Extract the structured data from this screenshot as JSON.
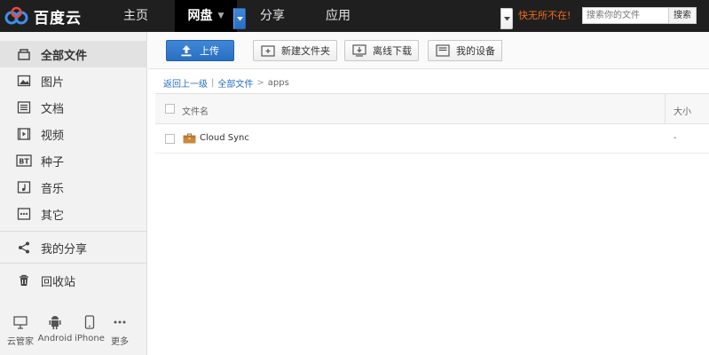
{
  "brand": {
    "name": "百度云"
  },
  "nav": {
    "items": [
      {
        "label": "主页"
      },
      {
        "label": "网盘"
      },
      {
        "label": "分享"
      },
      {
        "label": "应用"
      }
    ]
  },
  "promo": {
    "text": "快无所不在!"
  },
  "search": {
    "placeholder": "搜索你的文件",
    "button_label": "搜索"
  },
  "sidebar": {
    "items": [
      {
        "label": "全部文件",
        "icon": "all-files-icon"
      },
      {
        "label": "图片",
        "icon": "image-icon"
      },
      {
        "label": "文档",
        "icon": "document-icon"
      },
      {
        "label": "视频",
        "icon": "video-icon"
      },
      {
        "label": "种子",
        "icon": "bt-icon"
      },
      {
        "label": "音乐",
        "icon": "music-icon"
      },
      {
        "label": "其它",
        "icon": "other-icon"
      },
      {
        "label": "我的分享",
        "icon": "share-icon"
      },
      {
        "label": "回收站",
        "icon": "trash-icon"
      }
    ],
    "devices": [
      {
        "label": "云管家",
        "icon": "desktop-icon"
      },
      {
        "label": "Android",
        "icon": "android-icon"
      },
      {
        "label": "iPhone",
        "icon": "iphone-icon"
      },
      {
        "label": "更多",
        "icon": "more-icon"
      }
    ]
  },
  "toolbar": {
    "upload_label": "上传",
    "new_folder_label": "新建文件夹",
    "offline_download_label": "离线下载",
    "my_devices_label": "我的设备"
  },
  "breadcrumb": {
    "back_label": "返回上一级",
    "divider": "|",
    "root_label": "全部文件",
    "arrow": ">",
    "current": "apps"
  },
  "file_list": {
    "columns": {
      "name": "文件名",
      "size": "大小"
    },
    "rows": [
      {
        "name": "Cloud Sync",
        "size": "-",
        "icon": "folder-icon"
      }
    ]
  },
  "colors": {
    "topbar_bg": "#1f1f1f",
    "accent_blue": "#2a6fc1",
    "promo_orange": "#f26b1d",
    "sidebar_bg": "#f2f2f2"
  }
}
